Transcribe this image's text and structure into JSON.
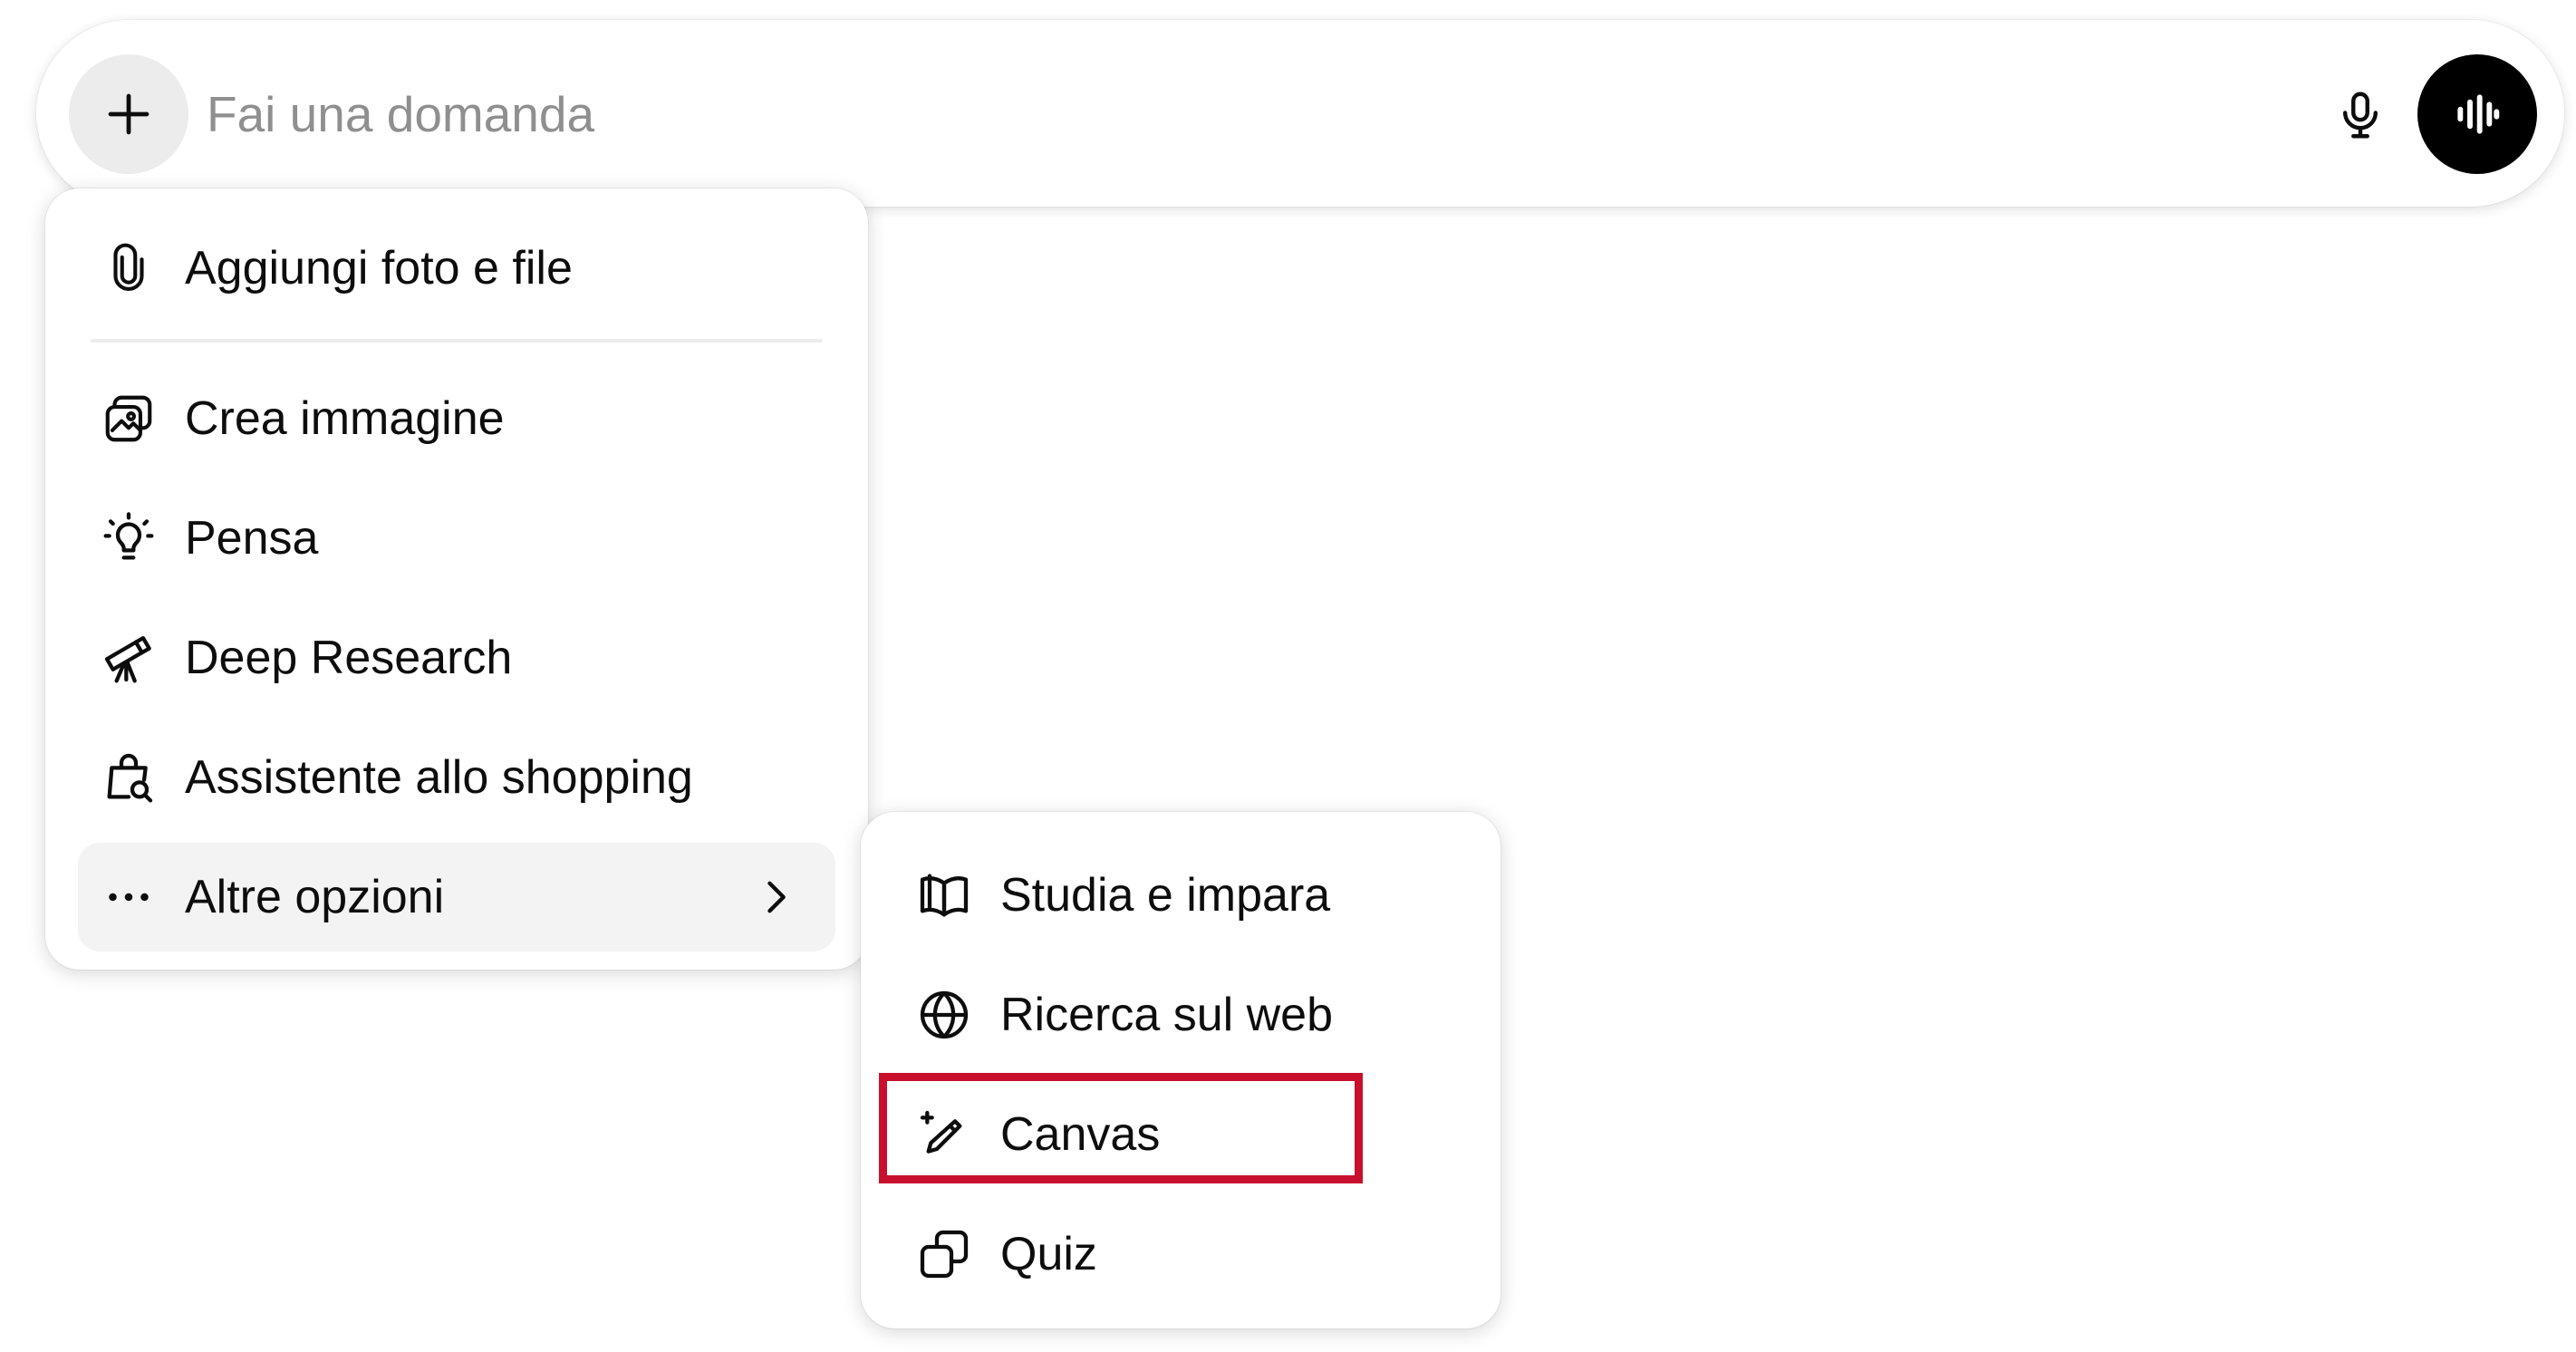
{
  "composer": {
    "placeholder": "Fai una domanda",
    "plus_icon": "plus-icon",
    "mic_icon": "microphone-icon",
    "voice_icon": "voice-waveform-icon"
  },
  "menu": {
    "items": [
      {
        "label": "Aggiungi foto e file",
        "icon": "paperclip-icon"
      },
      {
        "label": "Crea immagine",
        "icon": "image-create-icon"
      },
      {
        "label": "Pensa",
        "icon": "lightbulb-icon"
      },
      {
        "label": "Deep Research",
        "icon": "telescope-icon"
      },
      {
        "label": "Assistente allo shopping",
        "icon": "shopping-bag-icon"
      },
      {
        "label": "Altre opzioni",
        "icon": "more-dots-icon",
        "submenu": true
      }
    ]
  },
  "submenu": {
    "items": [
      {
        "label": "Studia e impara",
        "icon": "book-open-icon"
      },
      {
        "label": "Ricerca sul web",
        "icon": "globe-icon"
      },
      {
        "label": "Canvas",
        "icon": "canvas-pencil-icon",
        "highlighted": true
      },
      {
        "label": "Quiz",
        "icon": "quiz-cards-icon"
      }
    ]
  },
  "colors": {
    "highlight_border": "#c8102e",
    "voice_button": "#000000",
    "placeholder": "#8f8f8f"
  }
}
